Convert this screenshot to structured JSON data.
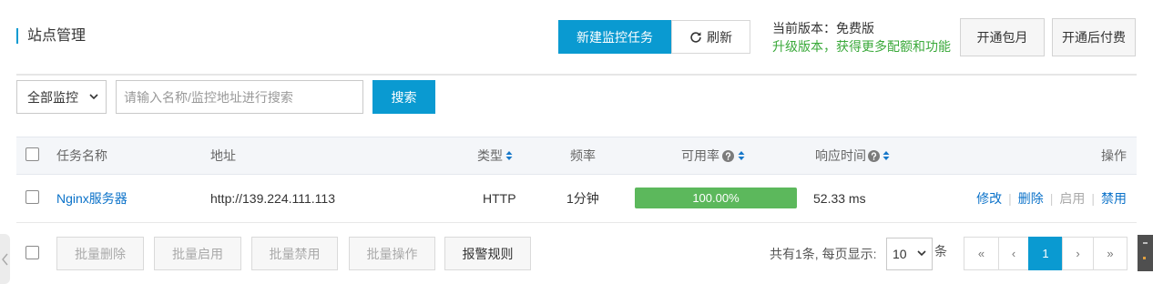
{
  "colors": {
    "primary": "#0a9ad1",
    "link": "#0b72c9",
    "upgrade_text": "#3aa93a",
    "progress_fill": "#5cb85c",
    "disabled_text": "#aaaaaa",
    "sort_icon": "#1677c9"
  },
  "icons": {
    "refresh": "refresh-icon",
    "select_arrow": "chevron-down-icon",
    "sort": "sort-icon",
    "help": "question-icon",
    "collapse": "chevron-left-icon"
  },
  "header": {
    "title": "站点管理",
    "new_task_label": "新建监控任务",
    "refresh_label": "刷新",
    "version_label": "当前版本：免费版",
    "upgrade_label": "升级版本，获得更多配额和功能",
    "monthly_label": "开通包月",
    "postpaid_label": "开通后付费"
  },
  "search": {
    "filter_selected": "全部监控",
    "placeholder": "请输入名称/监控地址进行搜索",
    "value": "",
    "button_label": "搜索"
  },
  "table": {
    "columns": {
      "name": "任务名称",
      "address": "地址",
      "type": "类型",
      "frequency": "频率",
      "availability": "可用率",
      "response_time": "响应时间",
      "actions": "操作"
    },
    "action_separator": "|",
    "rows": [
      {
        "checked": false,
        "name": "Nginx服务器",
        "address": "http://139.224.111.113",
        "type": "HTTP",
        "frequency": "1分钟",
        "availability": "100.00%",
        "availability_fraction": 1.0,
        "response_time": "52.33 ms",
        "actions": [
          {
            "label": "修改",
            "enabled": true
          },
          {
            "label": "删除",
            "enabled": true
          },
          {
            "label": "启用",
            "enabled": false
          },
          {
            "label": "禁用",
            "enabled": true
          }
        ]
      }
    ]
  },
  "footer": {
    "batch_buttons": [
      {
        "label": "批量删除",
        "enabled": false
      },
      {
        "label": "批量启用",
        "enabled": false
      },
      {
        "label": "批量禁用",
        "enabled": false
      },
      {
        "label": "批量操作",
        "enabled": false
      },
      {
        "label": "报警规则",
        "enabled": true
      }
    ],
    "total_text": "共有1条, 每页显示:",
    "page_size": "10",
    "page_size_unit": "条",
    "pagination": {
      "first": "«",
      "prev": "‹",
      "current": "1",
      "next": "›",
      "last": "»"
    }
  }
}
